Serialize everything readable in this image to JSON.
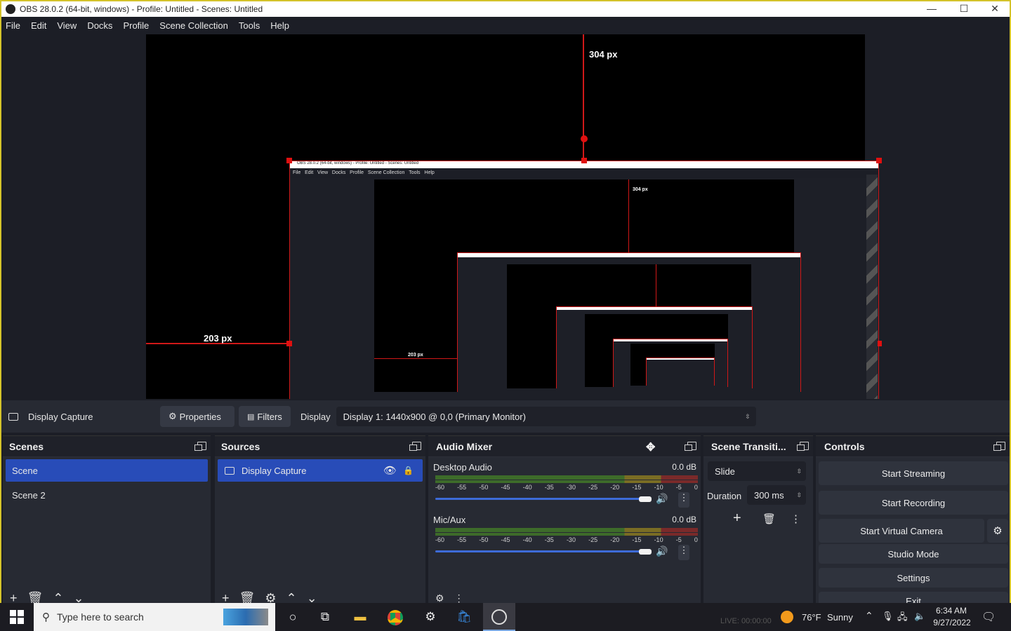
{
  "window": {
    "title": "OBS 28.0.2 (64-bit, windows) - Profile: Untitled - Scenes: Untitled",
    "minimize": "—",
    "maximize": "☐",
    "close": "✕"
  },
  "menu": [
    "File",
    "Edit",
    "View",
    "Docks",
    "Profile",
    "Scene Collection",
    "Tools",
    "Help"
  ],
  "preview": {
    "measure_top": "304 px",
    "measure_left": "203 px",
    "nested_measure_top": "304 px",
    "nested_measure_left": "203 px"
  },
  "context_bar": {
    "source_name": "Display Capture",
    "properties_label": "Properties",
    "filters_label": "Filters",
    "display_label": "Display",
    "display_value": "Display 1: 1440x900 @ 0,0 (Primary Monitor)"
  },
  "scenes": {
    "title": "Scenes",
    "items": [
      "Scene",
      "Scene 2"
    ],
    "selected": "Scene"
  },
  "sources": {
    "title": "Sources",
    "items": [
      "Display Capture"
    ]
  },
  "audio_mixer": {
    "title": "Audio Mixer",
    "channels": [
      {
        "name": "Desktop Audio",
        "level": "0.0 dB",
        "volume": 1.0
      },
      {
        "name": "Mic/Aux",
        "level": "0.0 dB",
        "volume": 1.0
      }
    ],
    "scale": [
      "-60",
      "-55",
      "-50",
      "-45",
      "-40",
      "-35",
      "-30",
      "-25",
      "-20",
      "-15",
      "-10",
      "-5",
      "0"
    ]
  },
  "transitions": {
    "title": "Scene Transiti...",
    "selected": "Slide",
    "duration_label": "Duration",
    "duration_value": "300 ms"
  },
  "controls": {
    "title": "Controls",
    "buttons": [
      "Start Streaming",
      "Start Recording",
      "Start Virtual Camera",
      "Studio Mode",
      "Settings",
      "Exit"
    ]
  },
  "taskbar": {
    "search_placeholder": "Type here to search",
    "status": "LIVE: 00:00:00",
    "weather_temp": "76°F",
    "weather_desc": "Sunny",
    "time": "6:34 AM",
    "date": "9/27/2022"
  }
}
